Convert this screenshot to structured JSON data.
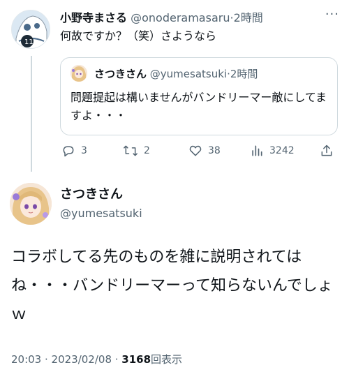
{
  "reply": {
    "display_name": "小野寺まさる",
    "handle": "@onoderamasaru",
    "separator": "·",
    "time": "2時間",
    "more_label": "···",
    "text": "何故ですか？（笑）さようなら"
  },
  "quoted": {
    "display_name": "さつきさん",
    "handle": "@yumesatsuki",
    "separator": "·",
    "time": "2時間",
    "text": "問題提起は構いませんがバンドリーマー敵にしてますよ・・・"
  },
  "actions": {
    "replies": "3",
    "retweets": "2",
    "likes": "38",
    "views": "3242"
  },
  "main_tweet": {
    "display_name": "さつきさん",
    "handle": "@yumesatsuki",
    "text": "コラボしてる先のものを雑に説明されてはね・・・バンドリーマーって知らないんでしょｗ",
    "timestamp": "20:03 · 2023/02/08 · ",
    "view_count": "3168",
    "view_label": "回表示"
  },
  "colors": {
    "text": "#0f1419",
    "muted": "#536471",
    "border": "#cfd9de"
  },
  "icons": [
    "reply-icon",
    "retweet-icon",
    "like-icon",
    "views-icon",
    "share-icon"
  ]
}
